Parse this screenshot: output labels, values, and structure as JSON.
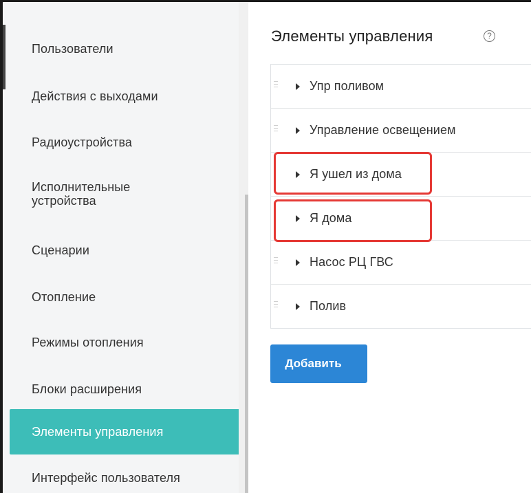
{
  "sidebar": {
    "items": [
      {
        "label": "Пользователи",
        "active": false
      },
      {
        "label": "Действия с выходами",
        "active": false
      },
      {
        "label": "Радиоустройства",
        "active": false
      },
      {
        "label": "Исполнительные устройства",
        "line1": "Исполнительные",
        "line2": "устройства",
        "active": false
      },
      {
        "label": "Сценарии",
        "active": false
      },
      {
        "label": "Отопление",
        "active": false
      },
      {
        "label": "Режимы отопления",
        "active": false
      },
      {
        "label": "Блоки расширения",
        "active": false
      },
      {
        "label": "Элементы управления",
        "active": true
      },
      {
        "label": "Интерфейс пользователя",
        "active": false
      }
    ]
  },
  "main": {
    "title": "Элементы управления",
    "help_icon": "question-circle-icon",
    "help_glyph": "?",
    "controls": [
      {
        "label": "Упр поливом",
        "highlighted": false
      },
      {
        "label": "Управление освещением",
        "highlighted": false
      },
      {
        "label": "Я ушел из дома",
        "highlighted": true
      },
      {
        "label": "Я дома",
        "highlighted": true
      },
      {
        "label": "Насос РЦ ГВС",
        "highlighted": false
      },
      {
        "label": "Полив",
        "highlighted": false
      }
    ],
    "add_button_label": "Добавить"
  },
  "colors": {
    "active_item_bg": "#3dbdb8",
    "add_button_bg": "#2c86d6",
    "highlight_border": "#e53935"
  }
}
